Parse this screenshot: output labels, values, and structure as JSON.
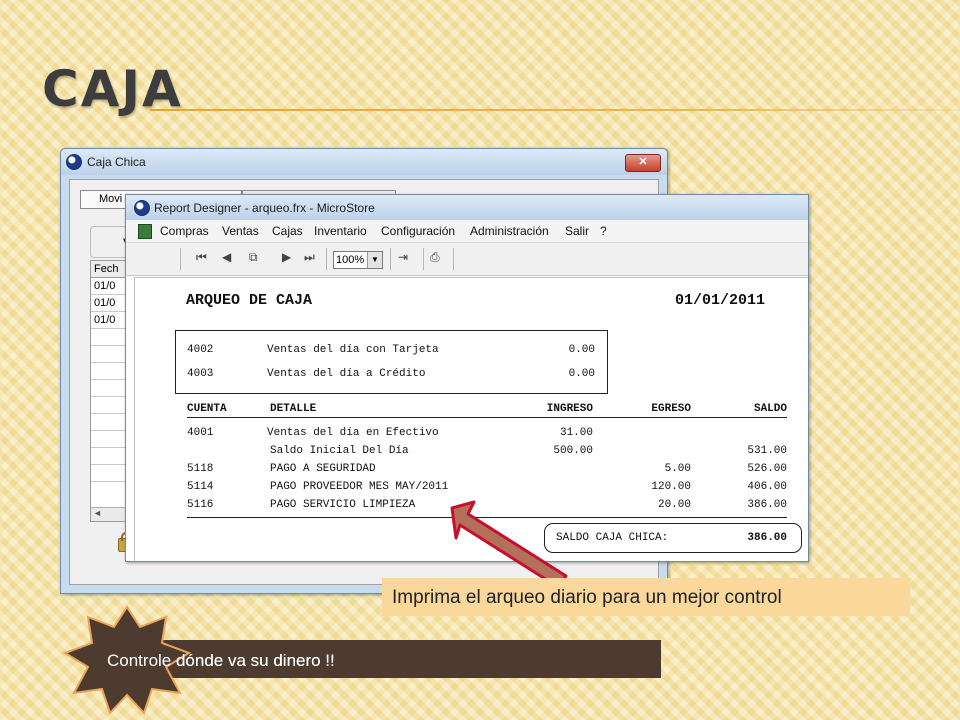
{
  "slide": {
    "title": "CAJA",
    "note": "Imprima el arqueo diario para un mejor control",
    "callout": "Controle dónde va su dinero !!"
  },
  "caja_window": {
    "title": "Caja Chica",
    "tab_visible": "Movi",
    "section_letter": "V",
    "grid_header": "Fech",
    "grid_rows": [
      "01/0",
      "01/0",
      "01/0"
    ],
    "scroll_left": "◄"
  },
  "report_window": {
    "title": "Report Designer - arqueo.frx - MicroStore",
    "menu": [
      "Compras",
      "Ventas",
      "Cajas",
      "Inventario",
      "Configuración",
      "Administración",
      "Salir",
      "?"
    ],
    "zoom": "100%"
  },
  "report": {
    "title": "ARQUEO DE CAJA",
    "date": "01/01/2011",
    "boxed": [
      {
        "cuenta": "4002",
        "detalle": "Ventas del día con Tarjeta",
        "ingreso": "0.00"
      },
      {
        "cuenta": "4003",
        "detalle": "Ventas del día a Crédito",
        "ingreso": "0.00"
      }
    ],
    "headers": {
      "cuenta": "CUENTA",
      "detalle": "DETALLE",
      "ingreso": "INGRESO",
      "egreso": "EGRESO",
      "saldo": "SALDO"
    },
    "rows": [
      {
        "cuenta": "4001",
        "detalle": "Ventas del día en Efectivo",
        "ingreso": "31.00",
        "egreso": "",
        "saldo": ""
      },
      {
        "cuenta": "",
        "detalle": "Saldo Inicial Del Día",
        "ingreso": "500.00",
        "egreso": "",
        "saldo": "531.00"
      },
      {
        "cuenta": "5118",
        "detalle": "PAGO A SEGURIDAD",
        "ingreso": "",
        "egreso": "5.00",
        "saldo": "526.00"
      },
      {
        "cuenta": "5114",
        "detalle": "PAGO PROVEEDOR MES MAY/2011",
        "ingreso": "",
        "egreso": "120.00",
        "saldo": "406.00"
      },
      {
        "cuenta": "5116",
        "detalle": "PAGO SERVICIO LIMPIEZA",
        "ingreso": "",
        "egreso": "20.00",
        "saldo": "386.00"
      }
    ],
    "total_label": "SALDO CAJA CHICA:",
    "total_value": "386.00"
  }
}
